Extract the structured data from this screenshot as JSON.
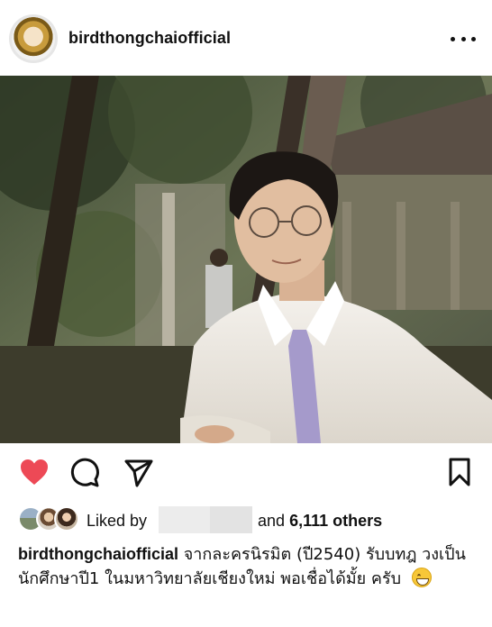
{
  "post": {
    "username": "birdthongchaiofficial",
    "more_icon": "more-horizontal-icon",
    "avatar_icon": "profile-avatar"
  },
  "actions": {
    "like_icon": "heart-filled-icon",
    "like_color": "#ed4956",
    "comment_icon": "comment-icon",
    "share_icon": "send-icon",
    "save_icon": "bookmark-icon"
  },
  "likes": {
    "prefix": "Liked by",
    "middle": "and",
    "count": "6,111 others"
  },
  "caption": {
    "username": "birdthongchaiofficial",
    "text": "จากละครนิรมิต (ปี2540) รับบทฎ วงเป็นนักศึกษาปี1 ในมหาวิทยาลัยเชียงใหม่ พอเชื่อได้มั้ย ครับ",
    "emoji": "grinning-face-emoji"
  }
}
